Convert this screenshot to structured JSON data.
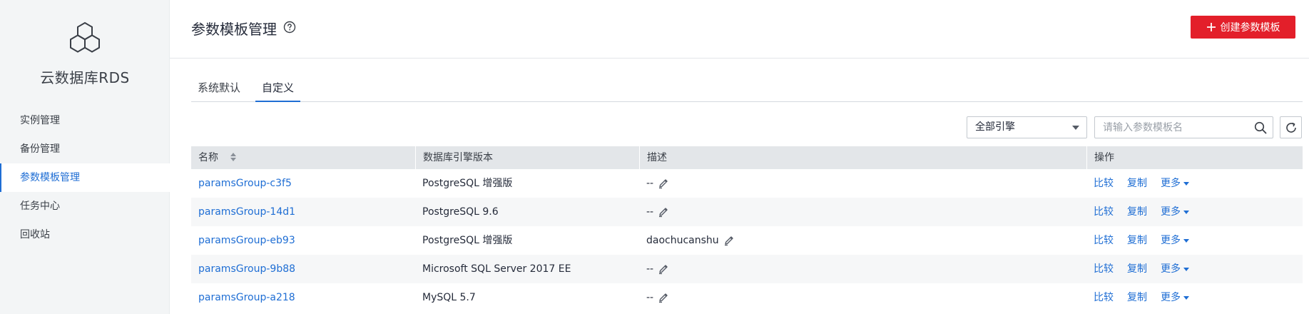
{
  "sidebar": {
    "brand": "云数据库RDS",
    "items": [
      {
        "label": "实例管理",
        "active": false
      },
      {
        "label": "备份管理",
        "active": false
      },
      {
        "label": "参数模板管理",
        "active": true
      },
      {
        "label": "任务中心",
        "active": false
      },
      {
        "label": "回收站",
        "active": false
      }
    ]
  },
  "header": {
    "title": "参数模板管理",
    "create_button_label": "创建参数模板"
  },
  "tabs": [
    {
      "label": "系统默认",
      "active": false
    },
    {
      "label": "自定义",
      "active": true
    }
  ],
  "toolbar": {
    "engine_filter": "全部引擎",
    "search_placeholder": "请输入参数模板名"
  },
  "table": {
    "columns": [
      "名称",
      "数据库引擎版本",
      "描述",
      "操作"
    ],
    "rows": [
      {
        "name": "paramsGroup-c3f5",
        "engine": "PostgreSQL 增强版",
        "description": "--"
      },
      {
        "name": "paramsGroup-14d1",
        "engine": "PostgreSQL 9.6",
        "description": "--"
      },
      {
        "name": "paramsGroup-eb93",
        "engine": "PostgreSQL 增强版",
        "description": "daochucanshu"
      },
      {
        "name": "paramsGroup-9b88",
        "engine": "Microsoft SQL Server 2017 EE",
        "description": "--"
      },
      {
        "name": "paramsGroup-a218",
        "engine": "MySQL 5.7",
        "description": "--"
      }
    ],
    "actions": {
      "compare": "比较",
      "copy": "复制",
      "more": "更多"
    }
  },
  "colors": {
    "accent": "#1f6ed4",
    "primary_button": "#e31f2a",
    "sidebar_bg": "#f3f5f6",
    "table_header_bg": "#e3e6e9"
  }
}
